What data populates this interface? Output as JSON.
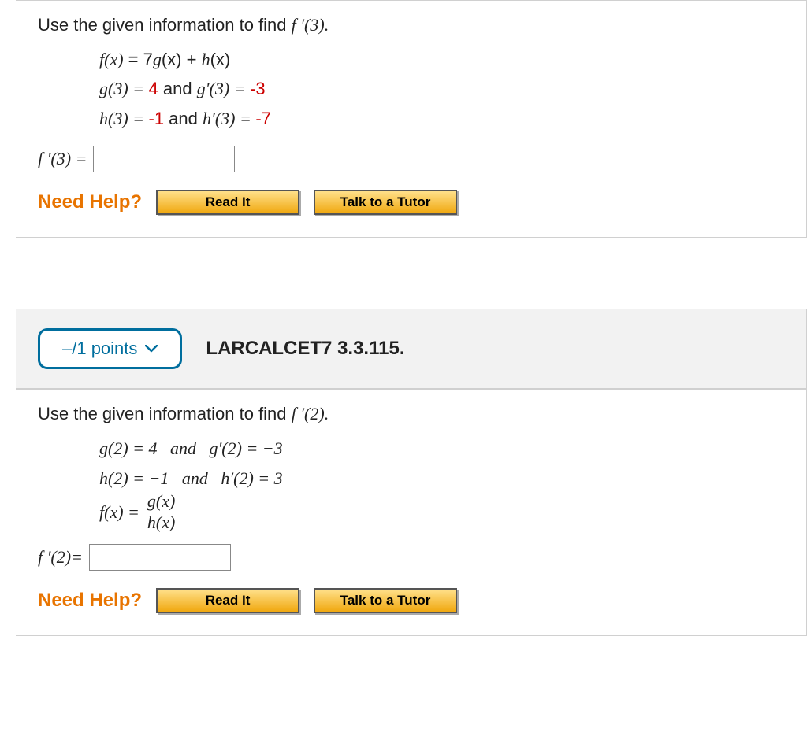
{
  "q1": {
    "instruction_prefix": "Use the given information to find ",
    "instruction_target": "f ′(3).",
    "line1_lhs": "f(x)",
    "line1_eq": " = 7",
    "line1_g": "g",
    "line1_gx": "(x)",
    "line1_plus": " + ",
    "line1_h": "h",
    "line1_hx": "(x)",
    "line2_a": "g(3) = ",
    "line2_v1": "4",
    "line2_mid": " and ",
    "line2_b": "g′(3) = ",
    "line2_v2": "-3",
    "line3_a": "h(3) = ",
    "line3_v1": "-1",
    "line3_mid": " and ",
    "line3_b": "h′(3) = ",
    "line3_v2": "-7",
    "answer_label": "f ′(3) = "
  },
  "header": {
    "points": "–/1 points",
    "reference": "LARCALCET7 3.3.115."
  },
  "q2": {
    "instruction_prefix": "Use the given information to find ",
    "instruction_target": "f ′(2).",
    "line1": "g(2) = 4   and   g′(2) = −3",
    "line2": "h(2) = −1   and   h′(2) = 3",
    "fx_lhs": "f(x) = ",
    "frac_num": "g(x)",
    "frac_den": "h(x)",
    "answer_label": "f ′(2)= "
  },
  "help": {
    "label": "Need Help?",
    "read": "Read It",
    "tutor": "Talk to a Tutor"
  }
}
